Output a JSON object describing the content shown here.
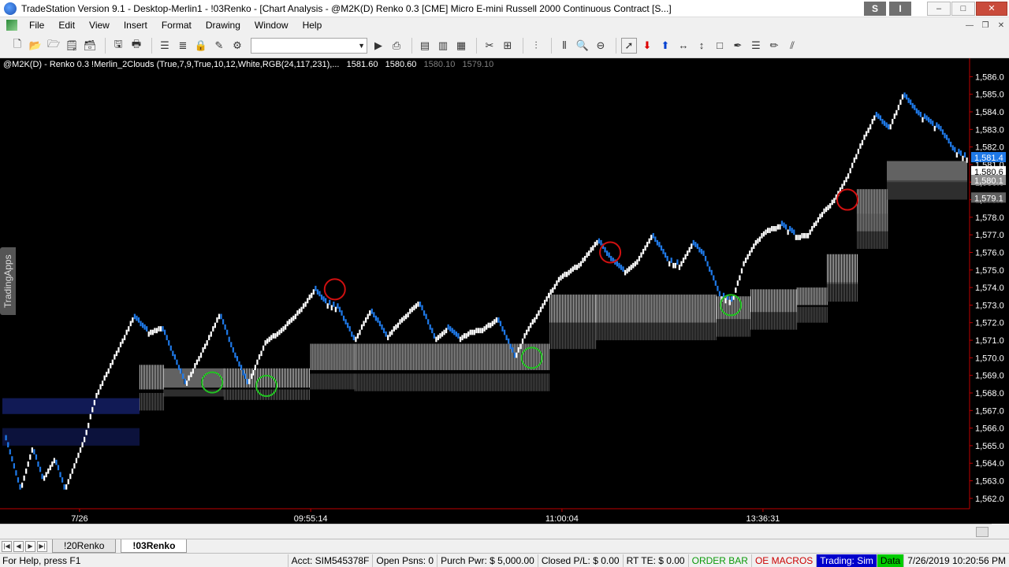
{
  "window": {
    "title": "TradeStation Version 9.1 - Desktop-Merlin1 - !03Renko - [Chart Analysis - @M2K(D) Renko 0.3 [CME] Micro E-mini Russell 2000 Continuous Contract [S...]",
    "s_badge": "S",
    "i_badge": "I",
    "minimize": "–",
    "maximize": "□",
    "close": "✕"
  },
  "menu": {
    "items": [
      "File",
      "Edit",
      "View",
      "Insert",
      "Format",
      "Drawing",
      "Window",
      "Help"
    ]
  },
  "toolbar": {
    "symbol_value": ""
  },
  "chart_header": {
    "text": "@M2K(D) - Renko 0.3  !Merlin_2Clouds (True,7,9,True,10,12,White,RGB(24,117,231),...",
    "v1": "1581.60",
    "v2": "1580.60",
    "v3": "1580.10",
    "v4": "1579.10"
  },
  "side_tab": "TradingApps",
  "colors": {
    "background": "#000000",
    "up_brick": "#ffffff",
    "down_brick": "#1e78e6",
    "axis_red": "#c00000",
    "cloud_light": "#e6e6e6",
    "cloud_dark": "#7a7a7a",
    "cloud_blue": "#283cc8"
  },
  "chart_data": {
    "type": "line",
    "title": "",
    "ylim": [
      1561.5,
      1586.6
    ],
    "y_ticks": [
      1562,
      1563,
      1564,
      1565,
      1566,
      1567,
      1568,
      1569,
      1570,
      1571,
      1572,
      1573,
      1574,
      1575,
      1576,
      1577,
      1578,
      1579,
      1580,
      1581,
      1582,
      1583,
      1584,
      1585,
      1586
    ],
    "y_tick_labels": [
      "1,562.0",
      "1,563.0",
      "1,564.0",
      "1,565.0",
      "1,566.0",
      "1,567.0",
      "1,568.0",
      "1,569.0",
      "1,570.0",
      "1,571.0",
      "1,572.0",
      "1,573.0",
      "1,574.0",
      "1,575.0",
      "1,576.0",
      "1,577.0",
      "1,578.0",
      "1,579.0",
      "1,580.0",
      "1,581.0",
      "1,582.0",
      "1,583.0",
      "1,584.0",
      "1,585.0",
      "1,586.0"
    ],
    "price_markers": [
      {
        "label": "1,581.4",
        "value": 1581.4,
        "color": "#1e78e6"
      },
      {
        "label": "1,580.6",
        "value": 1580.6,
        "color": "#ffffff"
      },
      {
        "label": "1,580.1",
        "value": 1580.1,
        "color": "#909090"
      },
      {
        "label": "1,579.1",
        "value": 1579.1,
        "color": "#606060"
      }
    ],
    "x_tick_labels": [
      "7/26",
      "09:55:14",
      "11:00:04",
      "13:36:31"
    ],
    "x_tick_bar_index": [
      38,
      153,
      278,
      378
    ],
    "waypoints": [
      [
        0,
        1565.7
      ],
      [
        8,
        1562.5
      ],
      [
        14,
        1564.9
      ],
      [
        19,
        1563.1
      ],
      [
        25,
        1564.3
      ],
      [
        30,
        1562.5
      ],
      [
        40,
        1565.5
      ],
      [
        46,
        1568.0
      ],
      [
        64,
        1572.3
      ],
      [
        71,
        1571.5
      ],
      [
        78,
        1571.8
      ],
      [
        86,
        1569.6
      ],
      [
        90,
        1568.5
      ],
      [
        100,
        1570.8
      ],
      [
        107,
        1572.5
      ],
      [
        115,
        1570.0
      ],
      [
        121,
        1568.5
      ],
      [
        130,
        1571.0
      ],
      [
        138,
        1571.7
      ],
      [
        148,
        1572.9
      ],
      [
        154,
        1573.9
      ],
      [
        159,
        1573.2
      ],
      [
        166,
        1572.8
      ],
      [
        174,
        1571.0
      ],
      [
        182,
        1572.7
      ],
      [
        190,
        1571.2
      ],
      [
        198,
        1572.3
      ],
      [
        206,
        1573.2
      ],
      [
        214,
        1571.1
      ],
      [
        220,
        1571.7
      ],
      [
        226,
        1571.1
      ],
      [
        232,
        1571.6
      ],
      [
        238,
        1571.7
      ],
      [
        245,
        1572.3
      ],
      [
        254,
        1570.0
      ],
      [
        259,
        1571.4
      ],
      [
        268,
        1573.1
      ],
      [
        276,
        1574.6
      ],
      [
        282,
        1575.1
      ],
      [
        287,
        1575.5
      ],
      [
        295,
        1576.7
      ],
      [
        302,
        1575.5
      ],
      [
        308,
        1574.9
      ],
      [
        315,
        1575.6
      ],
      [
        322,
        1577.0
      ],
      [
        330,
        1575.5
      ],
      [
        336,
        1575.3
      ],
      [
        342,
        1576.5
      ],
      [
        348,
        1575.8
      ],
      [
        356,
        1573.5
      ],
      [
        362,
        1573.2
      ],
      [
        368,
        1575.5
      ],
      [
        374,
        1576.7
      ],
      [
        380,
        1577.4
      ],
      [
        386,
        1577.6
      ],
      [
        393,
        1577.0
      ],
      [
        400,
        1577.1
      ],
      [
        406,
        1578.2
      ],
      [
        413,
        1579.1
      ],
      [
        420,
        1580.5
      ],
      [
        426,
        1582.2
      ],
      [
        433,
        1583.8
      ],
      [
        440,
        1583.0
      ],
      [
        447,
        1585.0
      ],
      [
        454,
        1583.9
      ],
      [
        460,
        1583.4
      ],
      [
        466,
        1582.9
      ],
      [
        472,
        1581.8
      ],
      [
        478,
        1581.4
      ]
    ],
    "signals": [
      {
        "bar": 104,
        "value": 1568.6,
        "color": "green"
      },
      {
        "bar": 131,
        "value": 1568.4,
        "color": "green"
      },
      {
        "bar": 165,
        "value": 1573.9,
        "color": "red"
      },
      {
        "bar": 263,
        "value": 1570.0,
        "color": "green"
      },
      {
        "bar": 302,
        "value": 1576.0,
        "color": "red"
      },
      {
        "bar": 362,
        "value": 1573.0,
        "color": "green"
      },
      {
        "bar": 420,
        "value": 1579.0,
        "color": "red"
      }
    ]
  },
  "tabs": [
    "!20Renko",
    "!03Renko"
  ],
  "status": {
    "help": "For Help, press F1",
    "acct": "Acct: SIM545378F",
    "open_psns": "Open Psns: 0",
    "purch_pwr": "Purch Pwr: $ 5,000.00",
    "closed_pl": "Closed P/L: $ 0.00",
    "rt_te": "RT TE: $ 0.00",
    "order_bar": "ORDER BAR",
    "oe_macros": "OE MACROS",
    "trading": "Trading: Sim",
    "data": "Data",
    "datetime": "7/26/2019 10:20:56 PM"
  }
}
